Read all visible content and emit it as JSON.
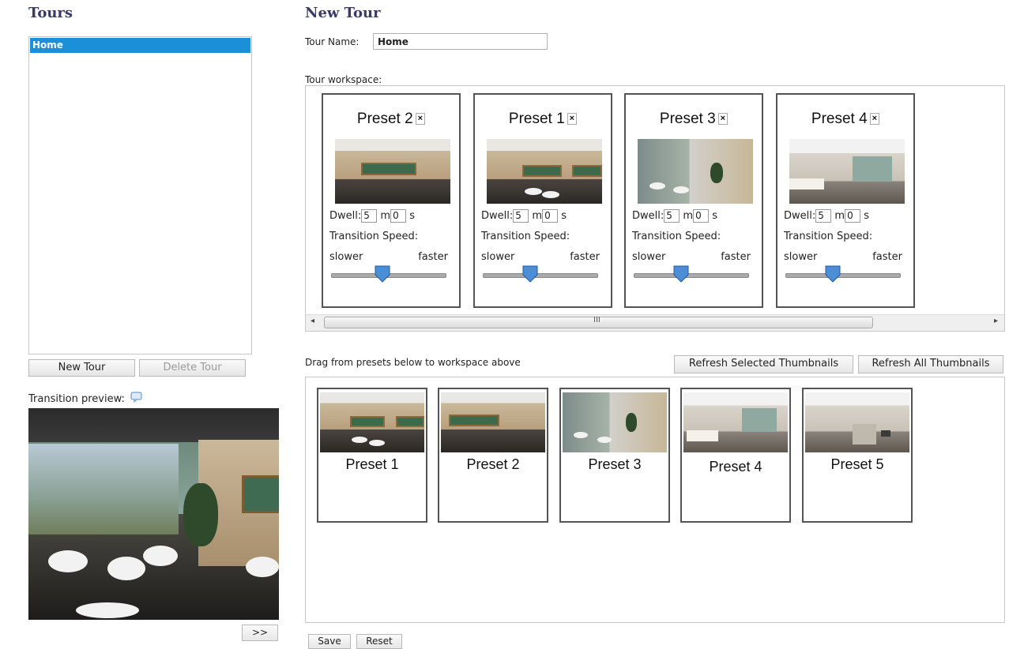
{
  "tours_panel": {
    "heading": "Tours",
    "items": [
      {
        "label": "Home",
        "selected": true
      }
    ],
    "new_tour_label": "New Tour",
    "delete_tour_label": "Delete Tour",
    "transition_preview_label": "Transition preview:",
    "next_label": ">>"
  },
  "editor": {
    "heading": "New Tour",
    "tour_name_label": "Tour Name:",
    "tour_name_value": "Home",
    "workspace_label": "Tour workspace:",
    "workspace_cards": [
      {
        "name": "Preset 2",
        "dwell_m": "5",
        "dwell_s": "0",
        "speed": 0.45
      },
      {
        "name": "Preset 1",
        "dwell_m": "5",
        "dwell_s": "0",
        "speed": 0.42
      },
      {
        "name": "Preset 3",
        "dwell_m": "5",
        "dwell_s": "0",
        "speed": 0.42
      },
      {
        "name": "Preset 4",
        "dwell_m": "5",
        "dwell_s": "0",
        "speed": 0.42
      }
    ],
    "dwell_label": "Dwell:",
    "minutes_unit": "m",
    "seconds_unit": "s",
    "transition_speed_label": "Transition Speed:",
    "slower_label": "slower",
    "faster_label": "faster",
    "close_glyph": "×",
    "scroll_grip": "III",
    "drag_hint": "Drag from presets below to workspace above",
    "refresh_selected_label": "Refresh Selected Thumbnails",
    "refresh_all_label": "Refresh All Thumbnails",
    "presets": [
      "Preset 1",
      "Preset 2",
      "Preset 3",
      "Preset 4",
      "Preset 5"
    ],
    "save_label": "Save",
    "reset_label": "Reset"
  },
  "colors": {
    "selection": "#1c8fd9",
    "heading": "#3a3a6a",
    "slider_knob": "#4a8fd6"
  },
  "icons": [
    "speech-bubble-icon",
    "close-icon",
    "slider-knob-icon",
    "scroll-left-arrow-icon",
    "scroll-right-arrow-icon"
  ]
}
